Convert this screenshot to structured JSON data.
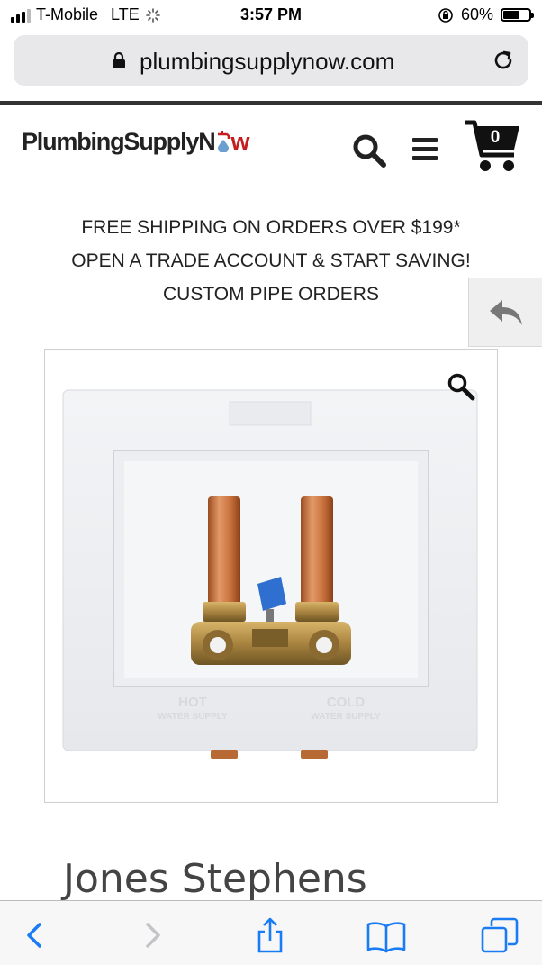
{
  "status_bar": {
    "carrier": "T-Mobile",
    "network": "LTE",
    "time": "3:57 PM",
    "battery_percent": "60%",
    "battery_level": 0.6
  },
  "browser": {
    "url": "plumbingsupplynow.com",
    "icons": [
      "lock-icon",
      "reload-icon"
    ]
  },
  "header": {
    "logo_text_part1": "PlumbingSupplyN",
    "logo_text_part2": "w",
    "cart_count": "0",
    "icons": [
      "search-icon",
      "menu-icon",
      "cart-icon"
    ]
  },
  "promo": {
    "line1": "FREE SHIPPING ON ORDERS OVER $199*",
    "line2": "OPEN A TRADE ACCOUNT & START SAVING!",
    "line3": "CUSTOM PIPE ORDERS"
  },
  "product": {
    "image_labels": {
      "hot": "HOT",
      "hot_sub": "WATER SUPPLY",
      "cold": "COLD",
      "cold_sub": "WATER SUPPLY"
    },
    "brand": "Jones Stephens"
  },
  "toolbar": {
    "icons": [
      "back-icon",
      "forward-icon",
      "share-icon",
      "bookmarks-icon",
      "tabs-icon"
    ]
  },
  "colors": {
    "brand_red": "#c41e1e",
    "ios_blue": "#1a7cf5",
    "copper": "#c8703c",
    "valve_blue": "#2f6fd0"
  }
}
